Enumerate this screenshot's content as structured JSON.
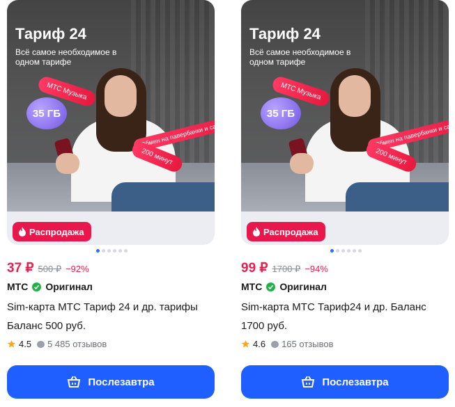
{
  "cards": [
    {
      "banner": {
        "title": "Тариф 24",
        "subtitle": "Всё самое необходимое в одном тарифе",
        "bubble_gb": "35 ГБ",
        "pill_music": "МТС Музыка",
        "pill_swap": "Обмен на павербанки и самокаты",
        "pill_minutes": "200 минут"
      },
      "badge": "Распродажа",
      "price": "37 ₽",
      "old_price": "500 ₽",
      "discount": "−92%",
      "brand": "МТС",
      "original_label": "Оригинал",
      "title": "Sim-карта МТС Тариф 24 и др. тарифы Баланс 500 руб.",
      "rating": "4.5",
      "reviews": "5 485 отзывов",
      "delivery_button": "Послезавтра"
    },
    {
      "banner": {
        "title": "Тариф 24",
        "subtitle": "Всё самое необходимое в одном тарифе",
        "bubble_gb": "35 ГБ",
        "pill_music": "МТС Музыка",
        "pill_swap": "Обмен на павербанки и самокаты",
        "pill_minutes": "200 минут"
      },
      "badge": "Распродажа",
      "price": "99 ₽",
      "old_price": "1700 ₽",
      "discount": "−94%",
      "brand": "МТС",
      "original_label": "Оригинал",
      "title": "Sim-карта МТС Тариф24 и др. Баланс 1700 руб.",
      "rating": "4.6",
      "reviews": "165 отзывов",
      "delivery_button": "Послезавтра"
    }
  ],
  "colors": {
    "accent_blue": "#1f5eff",
    "sale_red": "#e9184c",
    "check_green": "#22b24c"
  },
  "icons": {
    "sale": "fire-icon",
    "original": "check-circle-icon",
    "rating": "star-icon",
    "reviews": "comment-icon",
    "button": "basket-icon"
  }
}
